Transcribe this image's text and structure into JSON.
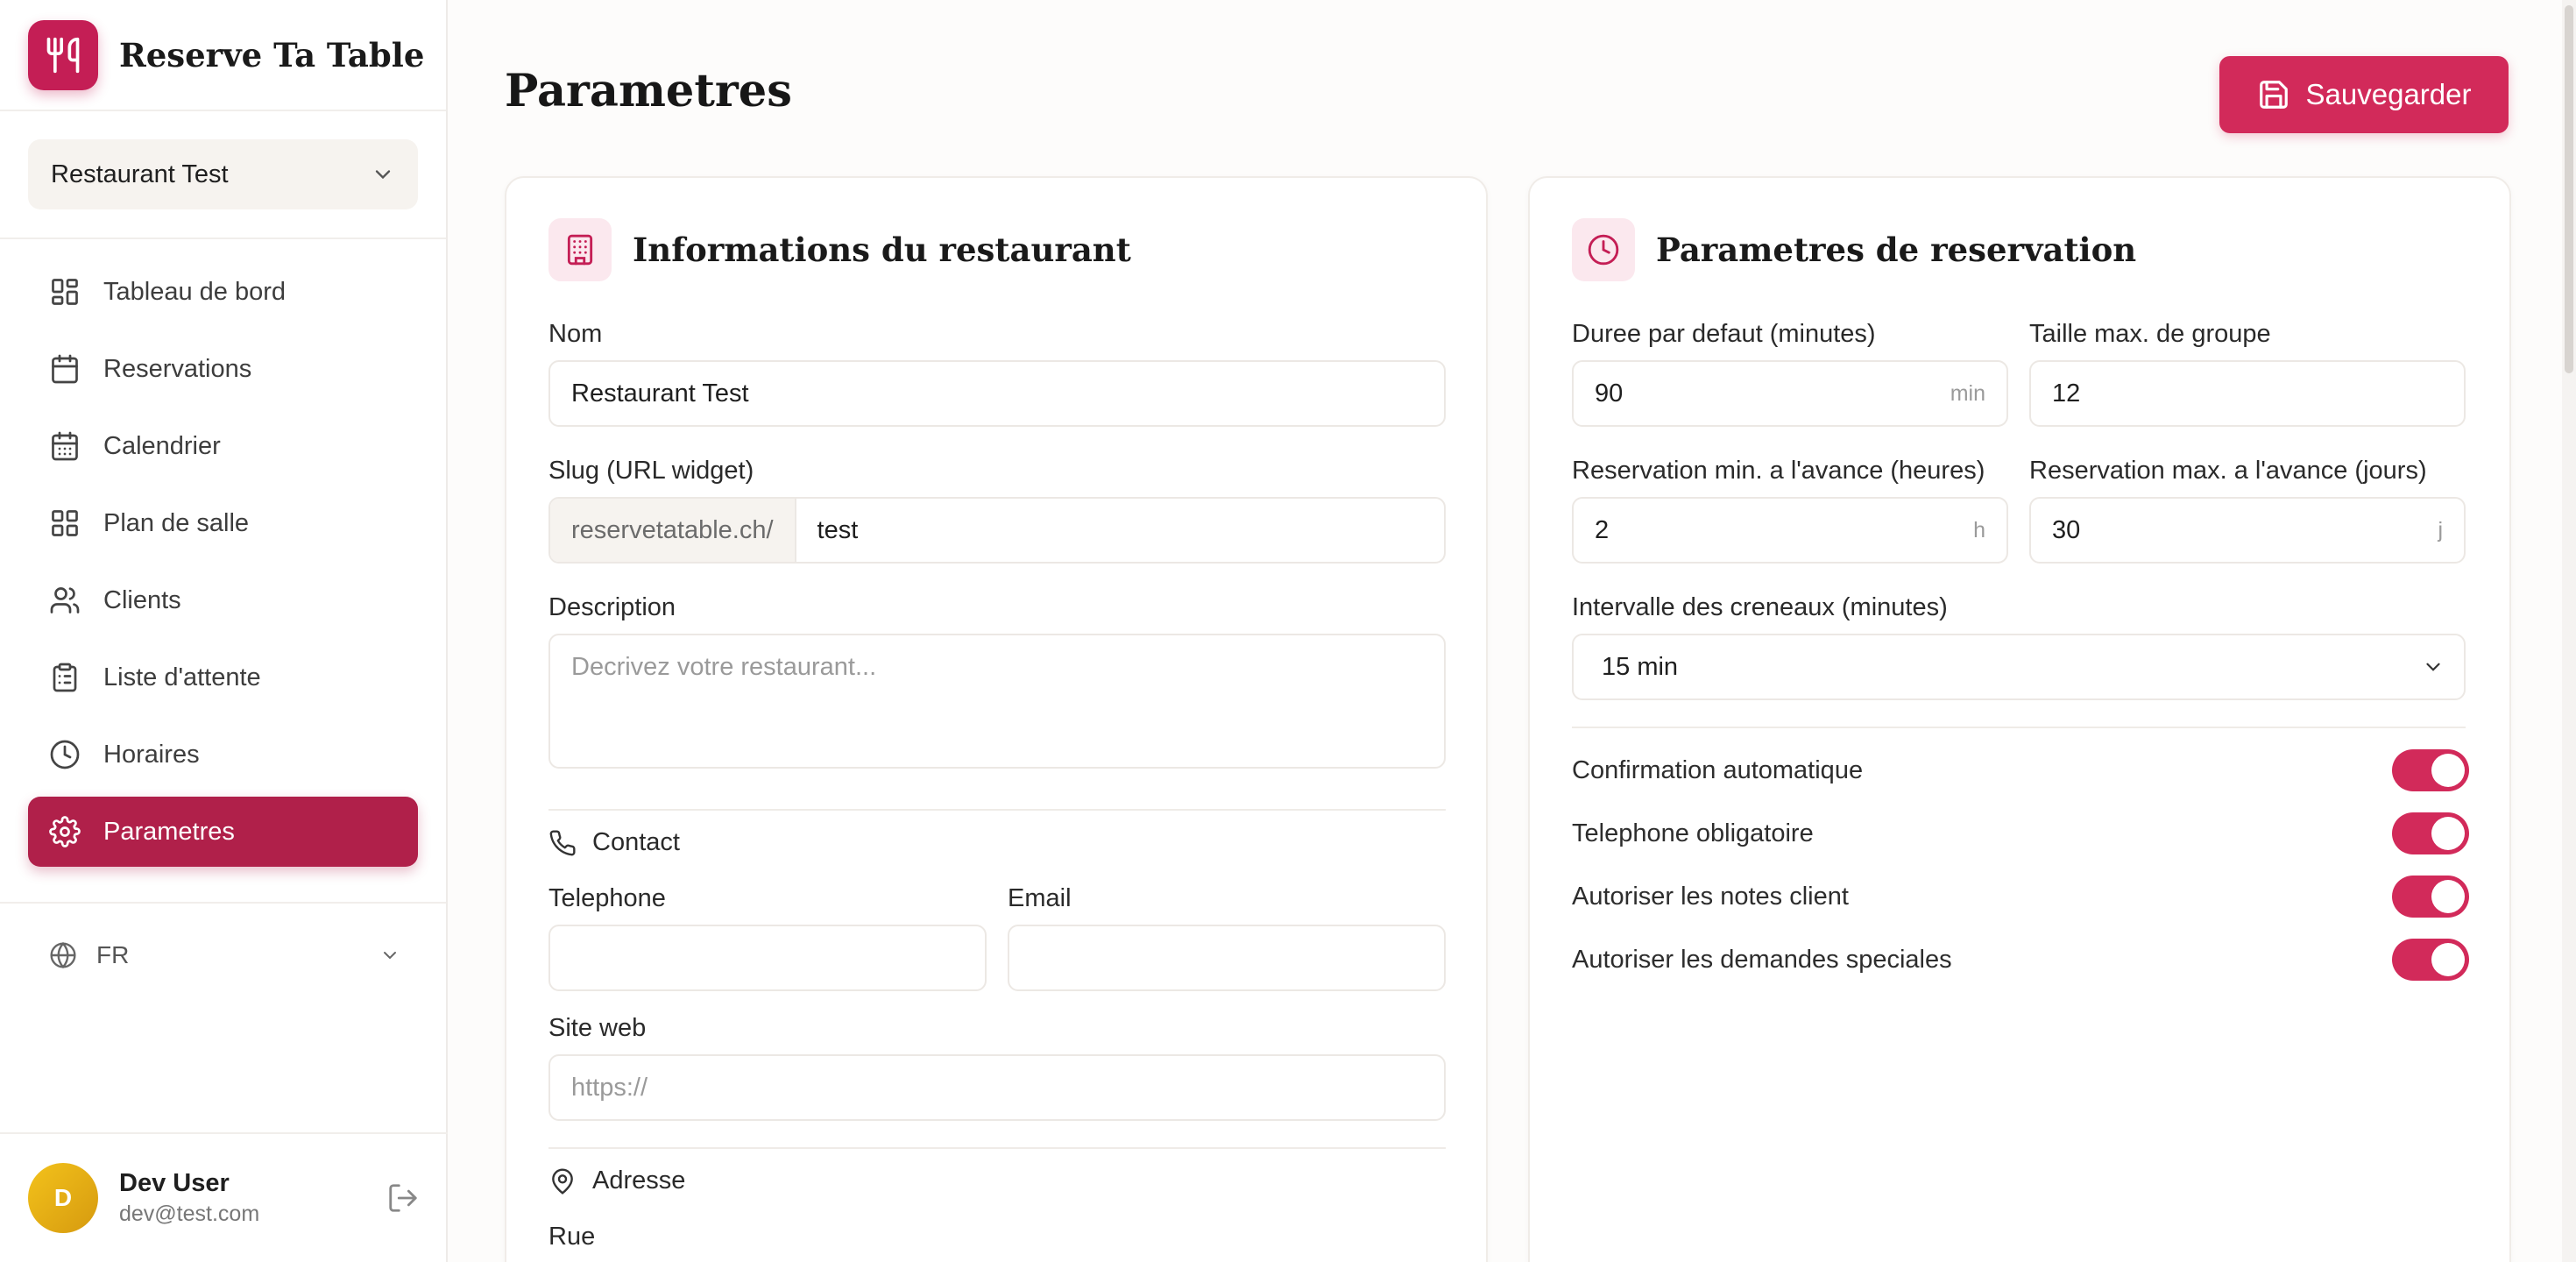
{
  "app": {
    "brand": "Reserve Ta Table"
  },
  "sidebar": {
    "restaurant_selector": "Restaurant Test",
    "items": [
      {
        "label": "Tableau de bord",
        "icon": "dashboard-icon"
      },
      {
        "label": "Reservations",
        "icon": "calendar-icon"
      },
      {
        "label": "Calendrier",
        "icon": "calendar-grid-icon"
      },
      {
        "label": "Plan de salle",
        "icon": "floor-plan-icon"
      },
      {
        "label": "Clients",
        "icon": "users-icon"
      },
      {
        "label": "Liste d'attente",
        "icon": "clipboard-icon"
      },
      {
        "label": "Horaires",
        "icon": "clock-icon"
      },
      {
        "label": "Parametres",
        "icon": "gear-icon",
        "active": true
      }
    ],
    "language": "FR",
    "user": {
      "initial": "D",
      "name": "Dev User",
      "email": "dev@test.com"
    }
  },
  "page": {
    "title": "Parametres",
    "save_label": "Sauvegarder"
  },
  "restaurant_info": {
    "title": "Informations du restaurant",
    "name_label": "Nom",
    "name_value": "Restaurant Test",
    "slug_label": "Slug (URL widget)",
    "slug_prefix": "reservetatable.ch/",
    "slug_value": "test",
    "description_label": "Description",
    "description_placeholder": "Decrivez votre restaurant...",
    "contact_title": "Contact",
    "phone_label": "Telephone",
    "phone_value": "",
    "email_label": "Email",
    "email_value": "",
    "website_label": "Site web",
    "website_placeholder": "https://",
    "address_title": "Adresse",
    "street_label": "Rue"
  },
  "reservation_settings": {
    "title": "Parametres de reservation",
    "duration_label": "Duree par defaut (minutes)",
    "duration_value": "90",
    "duration_unit": "min",
    "max_group_label": "Taille max. de groupe",
    "max_group_value": "12",
    "min_advance_label": "Reservation min. a l'avance (heures)",
    "min_advance_value": "2",
    "min_advance_unit": "h",
    "max_advance_label": "Reservation max. a l'avance (jours)",
    "max_advance_value": "30",
    "max_advance_unit": "j",
    "interval_label": "Intervalle des creneaux (minutes)",
    "interval_value": "15 min",
    "toggles": [
      {
        "label": "Confirmation automatique",
        "on": true
      },
      {
        "label": "Telephone obligatoire",
        "on": true
      },
      {
        "label": "Autoriser les notes client",
        "on": true
      },
      {
        "label": "Autoriser les demandes speciales",
        "on": true
      }
    ]
  },
  "colors": {
    "accent": "#d22a5a",
    "active_nav": "#b0204a",
    "icon_bg": "#fbe8ee"
  }
}
